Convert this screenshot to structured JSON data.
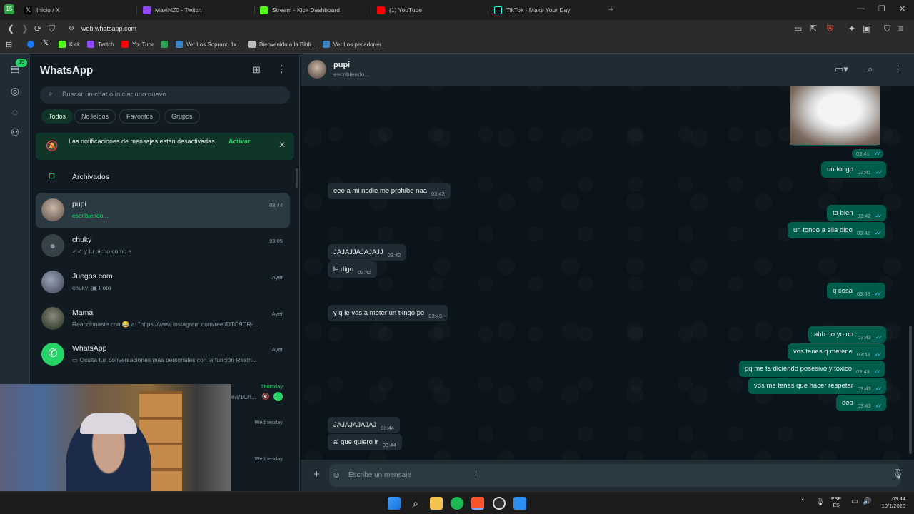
{
  "browser": {
    "tabs": [
      {
        "label": "Inicio / X",
        "color": "#ffffff"
      },
      {
        "label": "MaxiNZ0 - Twitch",
        "color": "#9146ff"
      },
      {
        "label": "Stream - Kick Dashboard",
        "color": "#53fc18"
      },
      {
        "label": "(1) YouTube",
        "color": "#ff0000"
      },
      {
        "label": "TikTok - Make Your Day",
        "color": "#ffffff"
      }
    ],
    "url": "web.whatsapp.com",
    "bookmarks": [
      "Kick",
      "Twitch",
      "YouTube",
      "Ver Los Soprano 1x...",
      "Bienvenido a la Bibli...",
      "Ver Los pecadores..."
    ]
  },
  "rail": {
    "badge": "15"
  },
  "sidebar": {
    "title": "WhatsApp",
    "search_placeholder": "Buscar un chat o iniciar uno nuevo",
    "filters": [
      "Todos",
      "No leídos",
      "Favoritos",
      "Grupos"
    ],
    "notice": {
      "text": "Las notificaciones de mensajes están desactivadas.",
      "action": "Activar"
    },
    "archived": "Archivados",
    "chats": [
      {
        "name": "pupi",
        "preview": "escribiendo...",
        "time": "03:44"
      },
      {
        "name": "chuky",
        "preview": "✓✓ y tu picho como e",
        "time": "03:05"
      },
      {
        "name": "Juegos.com",
        "preview": "chuky: ▣ Foto",
        "time": "Ayer"
      },
      {
        "name": "Mamá",
        "preview": "Reaccionaste con 😂 a: \"https://www.instagram.com/reel/DTO9CR-...",
        "time": "Ayer"
      },
      {
        "name": "WhatsApp",
        "preview": "▭ Oculta tus conversaciones más personales con la función Restri...",
        "time": "Ayer"
      },
      {
        "name": "",
        "preview": "e/r/1Cn...",
        "time": "Thursday",
        "unread": "1"
      },
      {
        "name": "",
        "preview": "",
        "time": "Wednesday"
      },
      {
        "name": "",
        "preview": "",
        "time": "Wednesday"
      }
    ]
  },
  "chat": {
    "contact": "pupi",
    "status": "escribiendo...",
    "messages": [
      {
        "dir": "out",
        "text": "",
        "time": "03:41"
      },
      {
        "dir": "out",
        "text": "un tongo",
        "time": "03:41"
      },
      {
        "dir": "in",
        "text": "eee a mi nadie me prohibe naa",
        "time": "03:42"
      },
      {
        "dir": "out",
        "text": "ta bien",
        "time": "03:42"
      },
      {
        "dir": "out",
        "text": "un tongo a ella digo",
        "time": "03:42"
      },
      {
        "dir": "in",
        "text": "JAJAJJAJAJAJJ",
        "time": "03:42"
      },
      {
        "dir": "in",
        "text": "le digo",
        "time": "03:42"
      },
      {
        "dir": "out",
        "text": "q cosa",
        "time": "03:43"
      },
      {
        "dir": "in",
        "text": "y q le vas a meter un tkngo pe",
        "time": "03:43"
      },
      {
        "dir": "out",
        "text": "ahh no yo no",
        "time": "03:43"
      },
      {
        "dir": "out",
        "text": "vos tenes q meterle",
        "time": "03:43"
      },
      {
        "dir": "out",
        "text": "pq me ta diciendo posesivo y toxico",
        "time": "03:43"
      },
      {
        "dir": "out",
        "text": "vos me tenes que hacer respetar",
        "time": "03:43"
      },
      {
        "dir": "out",
        "text": "dea",
        "time": "03:43"
      },
      {
        "dir": "in",
        "text": "JAJAJAJAJAJ",
        "time": "03:44"
      },
      {
        "dir": "in",
        "text": "al que quiero ir",
        "time": "03:44"
      }
    ],
    "composer_placeholder": "Escribe un mensaje"
  },
  "taskbar": {
    "lang": "ESP",
    "lang2": "ES",
    "time": "03:44",
    "date": "10/1/2026"
  }
}
